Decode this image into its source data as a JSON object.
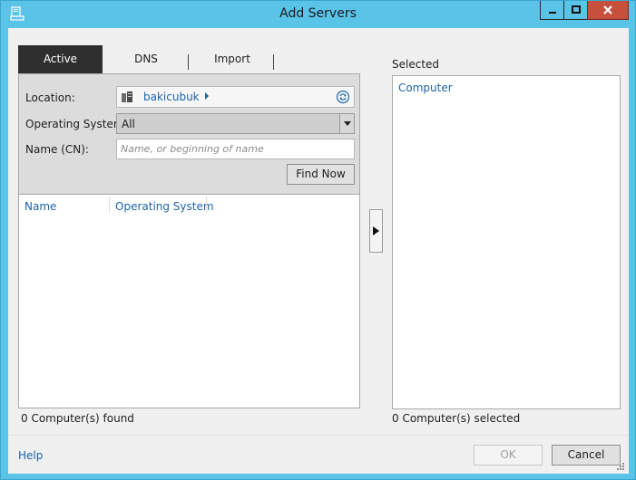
{
  "window": {
    "title": "Add Servers"
  },
  "tabs": [
    {
      "label": "Active Directory",
      "active": true
    },
    {
      "label": "DNS",
      "active": false
    },
    {
      "label": "Import",
      "active": false
    }
  ],
  "search": {
    "location_label": "Location:",
    "location_value": "bakicubuk",
    "os_label": "Operating System:",
    "os_value": "All",
    "name_label": "Name (CN):",
    "name_placeholder": "Name, or beginning of name",
    "name_value": "",
    "find_button": "Find Now"
  },
  "results": {
    "columns": [
      "Name",
      "Operating System"
    ],
    "rows": [],
    "status": "0 Computer(s) found"
  },
  "selected": {
    "label": "Selected",
    "column": "Computer",
    "rows": [],
    "status": "0 Computer(s) selected"
  },
  "footer": {
    "help": "Help",
    "ok": "OK",
    "cancel": "Cancel"
  },
  "colors": {
    "title_bar": "#5ac3e8",
    "close_button": "#c7503d",
    "active_tab": "#2f2f2f",
    "link": "#1d64a8"
  },
  "icons": {
    "app": "server-manager-icon",
    "location": "domain-icon",
    "refresh": "refresh-icon",
    "move": "arrow-right-icon"
  }
}
